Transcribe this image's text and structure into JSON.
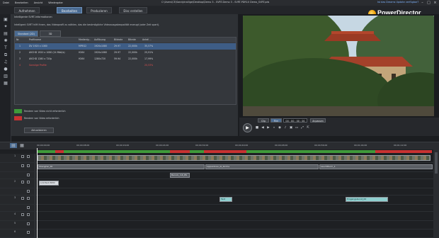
{
  "menubar": {
    "items": [
      "Datei",
      "Bearbeiten",
      "Ansicht",
      "Wiedergabe"
    ],
    "path": "C:\\Users\\CE\\Sandykrallige\\Desktop\\Demo 3 - SVRT-Demo 3 - SVRT-PDR10 Demo_SVRT.pds",
    "help_link": "Ist das Dreams Update verfügbar?"
  },
  "modes": {
    "tabs": [
      "Aufnehmen",
      "Bearbeiten",
      "Produzieren",
      "Disc erstellen"
    ],
    "active": 1
  },
  "brand": {
    "name": "PowerDirector"
  },
  "panel": {
    "header": "Intelligente SVRT-Informationen",
    "info": "Intelligent SVRT hilft Ihnen, das Videoprofil zu wählen, das die bestmögliche Videoausgabequalität erzeugt (oder Zeit spart).",
    "tabs": [
      "Standard (2D)",
      "3D"
    ],
    "active_tab": 0,
    "columns": [
      "Nr.",
      "Profilname",
      "Medienty...",
      "Auflösung",
      "Bildrate",
      "Bitrate",
      "Anteil ..."
    ],
    "rows": [
      {
        "num": "1",
        "name": "DV 1920 x 1080",
        "type": "MPEG2",
        "res": "1920x1080",
        "fps": "29.97",
        "bitrate": "22,000k",
        "share": "35,57%",
        "selected": true
      },
      {
        "num": "2",
        "name": "AVCHD 1920 x 1080 (24 Mbit/s)",
        "type": "H264",
        "res": "1920x1080",
        "fps": "29.97",
        "bitrate": "22,000k",
        "share": "25,91%",
        "selected": false
      },
      {
        "num": "3",
        "name": "AVCHD 1280 x 720p",
        "type": "H264",
        "res": "1280x720",
        "fps": "59.94",
        "bitrate": "22,000k",
        "share": "17,99%",
        "selected": false
      },
      {
        "num": "4",
        "name": "Sonstige Profile",
        "type": "",
        "res": "",
        "fps": "",
        "bitrate": "",
        "share": "20,53%",
        "selected": false,
        "red": true
      }
    ],
    "legend": [
      {
        "label": "Rendern von Video nicht erforderlich",
        "color": "#3f9a3a"
      },
      {
        "label": "Rendern von Video erforderlich",
        "color": "#c83232"
      }
    ],
    "apply_button": "Aktualisieren"
  },
  "preview": {
    "clip_label": "Clip",
    "movie_label": "Film",
    "timecode": "00 : 00 : 00 : 00",
    "view_label": "Anpassen"
  },
  "timeline": {
    "ruler": [
      "00;00;00;00",
      "00;00;08;00",
      "00;00;16;00",
      "00;00;24;00",
      "00;00;32;00",
      "00;00;40;00",
      "00;00;48;00",
      "00;00;56;00",
      "00;01;04;00",
      "00;01;12;00"
    ],
    "track_numbers": [
      "1",
      "",
      "2",
      "",
      "3",
      "",
      "4",
      "",
      "5",
      "6"
    ],
    "clips": [
      "Shanghai_00",
      "Lippenbrau_bl_Kirche",
      "Leuchtturm_1",
      "Barock_mit_BS",
      "LinkText.WMV",
      "Text",
      "Eingangskunst_00"
    ]
  }
}
